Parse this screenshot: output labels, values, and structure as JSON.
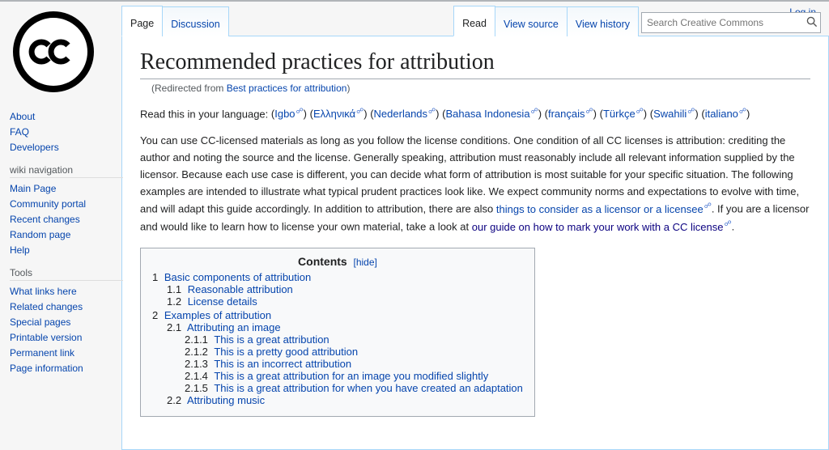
{
  "personal": {
    "login": "Log in"
  },
  "search": {
    "placeholder": "Search Creative Commons"
  },
  "tabs_left": [
    {
      "label": "Page",
      "active": true
    },
    {
      "label": "Discussion",
      "active": false
    }
  ],
  "tabs_right": [
    {
      "label": "Read",
      "active": true
    },
    {
      "label": "View source",
      "active": false
    },
    {
      "label": "View history",
      "active": false
    }
  ],
  "sidebar": {
    "primary": [
      "About",
      "FAQ",
      "Developers"
    ],
    "nav_heading": "wiki navigation",
    "nav": [
      "Main Page",
      "Community portal",
      "Recent changes",
      "Random page",
      "Help"
    ],
    "tools_heading": "Tools",
    "tools": [
      "What links here",
      "Related changes",
      "Special pages",
      "Printable version",
      "Permanent link",
      "Page information"
    ]
  },
  "title": "Recommended practices for attribution",
  "redirected_prefix": "(Redirected from ",
  "redirected_link": "Best practices for attribution",
  "redirected_suffix": ")",
  "lang_prefix": "Read this in your language: ",
  "languages": [
    "Igbo",
    "Ελληνικά",
    "Nederlands",
    "Bahasa Indonesia",
    "français",
    "Türkçe",
    "Swahili",
    "italiano"
  ],
  "intro_parts": {
    "p1": "You can use CC-licensed materials as long as you follow the license conditions. One condition of all CC licenses is attribution: crediting the author and noting the source and the license. Generally speaking, attribution must reasonably include all relevant information supplied by the licensor. Because each use case is different, you can decide what form of attribution is most suitable for your specific situation. The following examples are intended to illustrate what typical prudent practices look like. We expect community norms and expectations to evolve with time, and will adapt this guide accordingly. In addition to attribution, there are also ",
    "link1": "things to consider as a licensor or a licensee",
    "p2": ". If you are a licensor and would like to learn how to license your own material, take a look at ",
    "link2": "our guide on how to mark your work with a CC license",
    "p3": "."
  },
  "toc": {
    "heading": "Contents",
    "hide": "[hide]",
    "items": [
      {
        "n": "1",
        "t": "Basic components of attribution",
        "sub": [
          {
            "n": "1.1",
            "t": "Reasonable attribution"
          },
          {
            "n": "1.2",
            "t": "License details"
          }
        ]
      },
      {
        "n": "2",
        "t": "Examples of attribution",
        "sub": [
          {
            "n": "2.1",
            "t": "Attributing an image",
            "sub": [
              {
                "n": "2.1.1",
                "t": "This is a great attribution"
              },
              {
                "n": "2.1.2",
                "t": "This is a pretty good attribution"
              },
              {
                "n": "2.1.3",
                "t": "This is an incorrect attribution"
              },
              {
                "n": "2.1.4",
                "t": "This is a great attribution for an image you modified slightly"
              },
              {
                "n": "2.1.5",
                "t": "This is a great attribution for when you have created an adaptation"
              }
            ]
          },
          {
            "n": "2.2",
            "t": "Attributing music"
          }
        ]
      }
    ]
  }
}
